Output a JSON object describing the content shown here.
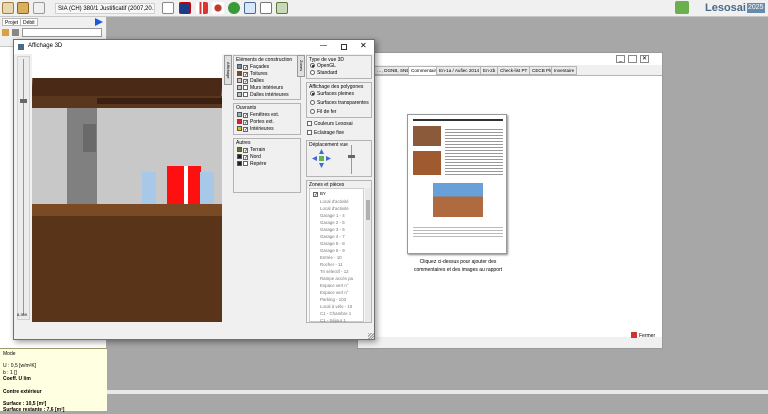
{
  "toolbar": {
    "project_dropdown": "SIA (CH) 380/1 Justificatif (2007,20…",
    "brand": "Lesosai",
    "brand_year": "2025"
  },
  "left": {
    "tab_projet": "Projet",
    "tab_debit": "Débit"
  },
  "info": {
    "line1": "Mode",
    "line2": "U : 0,5 [w/m²K]",
    "line3": "b : 1 []",
    "line4": "Coeff. U lim",
    "line5": "Contre extérieur",
    "line6": "Surface : 10,5 [m²]",
    "line7": "Surface restante : 7,6 [m²]"
  },
  "bgwin": {
    "tabs": [
      "…, DGNB, SNBS",
      "Commentaire",
      "En-1a / Aufiec 2014",
      "En-2b",
      "Check-list PT",
      "CECB Plus",
      "Inventaire"
    ],
    "hint1": "Cliquez ci-dessus pour ajouter des",
    "hint2": "commentaires et des images au rapport",
    "close": "Fermer"
  },
  "win3d": {
    "title": "Affichage 3D",
    "slider_value": "8,359",
    "construction": {
      "title": "Eléments de construction",
      "items": [
        {
          "label": "Façades",
          "checked": true,
          "color": "#6a8fa8"
        },
        {
          "label": "Toitures",
          "checked": true,
          "color": "#7a4a2a"
        },
        {
          "label": "Dalles",
          "checked": true,
          "color": "#c8c8c8"
        },
        {
          "label": "Murs intérieurs",
          "checked": false,
          "color": "#c8c8c8"
        },
        {
          "label": "Dalles intérieures",
          "checked": false,
          "color": "#a0c8d0"
        }
      ]
    },
    "ouvrants": {
      "title": "Ouvrants",
      "items": [
        {
          "label": "Fenêtres ext.",
          "checked": true,
          "color": "#8ab4d8"
        },
        {
          "label": "Portes ext.",
          "checked": true,
          "color": "#e02020"
        },
        {
          "label": "Intérieures",
          "checked": true,
          "color": "#e0c000"
        }
      ]
    },
    "autres": {
      "title": "Autres",
      "items": [
        {
          "label": "Terrain",
          "checked": true,
          "color": "#5a7a2a"
        },
        {
          "label": "Nord",
          "checked": true,
          "color": "#202020"
        },
        {
          "label": "Repère",
          "checked": false,
          "color": "#202020"
        }
      ]
    },
    "vlabel_left": "Affichage",
    "vlabel_right": "Zones",
    "vue": {
      "title": "Type de vue 3D",
      "opts": [
        "OpenGL",
        "Standard"
      ]
    },
    "polys": {
      "title": "Affichage des polygones",
      "opts": [
        "Surfaces pleines",
        "Surfaces transparentes",
        "Fil de fer"
      ]
    },
    "couleurs": "Couleurs Lesosai",
    "eclairage": "Eclairage fixe",
    "deplacement": "Déplacement vue",
    "zones": {
      "title": "Zones et pièces",
      "root": "BY",
      "items": [
        "Local d'activité",
        "Local d'activité",
        "Garage 1 - 4",
        "Garage 2 - 5",
        "Garage 3 - 6",
        "Garage 4 - 7",
        "Garage 5 - 8",
        "Garage 6 - 9",
        "Entrée - 10",
        "Rocher - 11",
        "Tri sélectif - 12",
        "Rampe accès pa",
        "Espace vert n°",
        "Espace vert n°",
        "Parking - 103",
        "Local à vélo - 10",
        "C1 - Chambre 1",
        "C1 - Séjour 1"
      ]
    }
  }
}
